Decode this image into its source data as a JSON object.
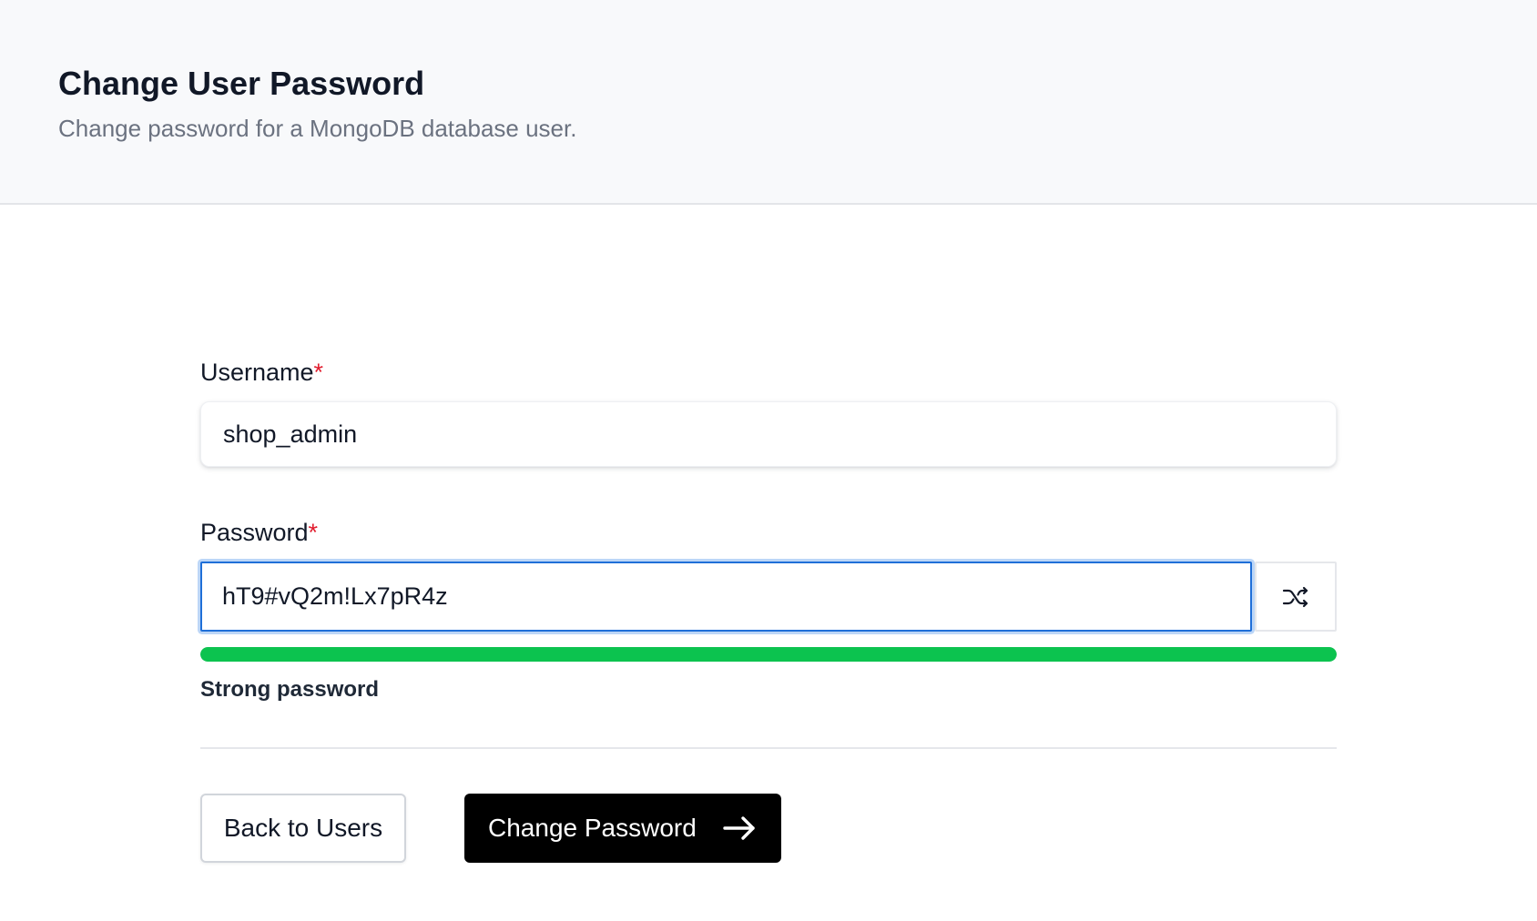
{
  "header": {
    "title": "Change User Password",
    "subtitle": "Change password for a MongoDB database user."
  },
  "form": {
    "username": {
      "label": "Username",
      "required_mark": "*",
      "value": "shop_admin"
    },
    "password": {
      "label": "Password",
      "required_mark": "*",
      "value": "hT9#vQ2m!Lx7pR4z",
      "generate_icon": "shuffle-icon"
    },
    "strength": {
      "level_percent": 100,
      "label": "Strong password",
      "color": "#0cc34f"
    }
  },
  "actions": {
    "back_label": "Back to Users",
    "submit_label": "Change Password",
    "submit_icon": "arrow-right-icon"
  },
  "colors": {
    "focus_border": "#1f6fd8",
    "required": "#e11d2e",
    "primary_button": "#000000"
  }
}
